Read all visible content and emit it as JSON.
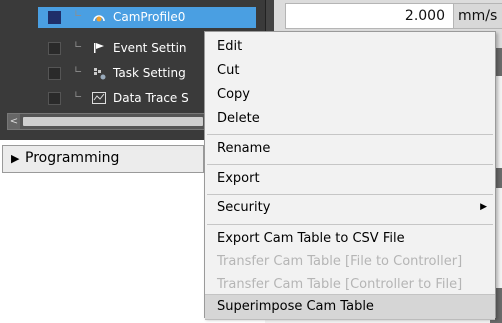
{
  "tree": {
    "items": [
      {
        "label": "CamProfile0",
        "icon": "cam-profile-icon",
        "selected": true
      },
      {
        "label": "Event Settin",
        "icon": "event-flag-icon",
        "selected": false
      },
      {
        "label": "Task Setting",
        "icon": "task-icon",
        "selected": false
      },
      {
        "label": "Data Trace S",
        "icon": "data-trace-icon",
        "selected": false
      }
    ]
  },
  "programming": {
    "arrow": "▶",
    "label": "Programming"
  },
  "speed": {
    "value": "2.000",
    "unit": "mm/s"
  },
  "context_menu": {
    "items": [
      {
        "label": "Edit",
        "enabled": true
      },
      {
        "label": "Cut",
        "enabled": true
      },
      {
        "label": "Copy",
        "enabled": true
      },
      {
        "label": "Delete",
        "enabled": true
      },
      {
        "label": "Rename",
        "enabled": true
      },
      {
        "label": "Export",
        "enabled": true
      },
      {
        "label": "Security",
        "enabled": true,
        "submenu": true
      },
      {
        "label": "Export Cam Table to CSV File",
        "enabled": true
      },
      {
        "label": "Transfer Cam Table [File to Controller]",
        "enabled": false
      },
      {
        "label": "Transfer Cam Table [Controller to File]",
        "enabled": false
      },
      {
        "label": "Superimpose Cam Table",
        "enabled": true,
        "hovered": true
      }
    ]
  },
  "colors": {
    "selection": "#4a9fe2",
    "tree_bg": "#3a3a3a",
    "menu_bg": "#f2f2f2"
  }
}
